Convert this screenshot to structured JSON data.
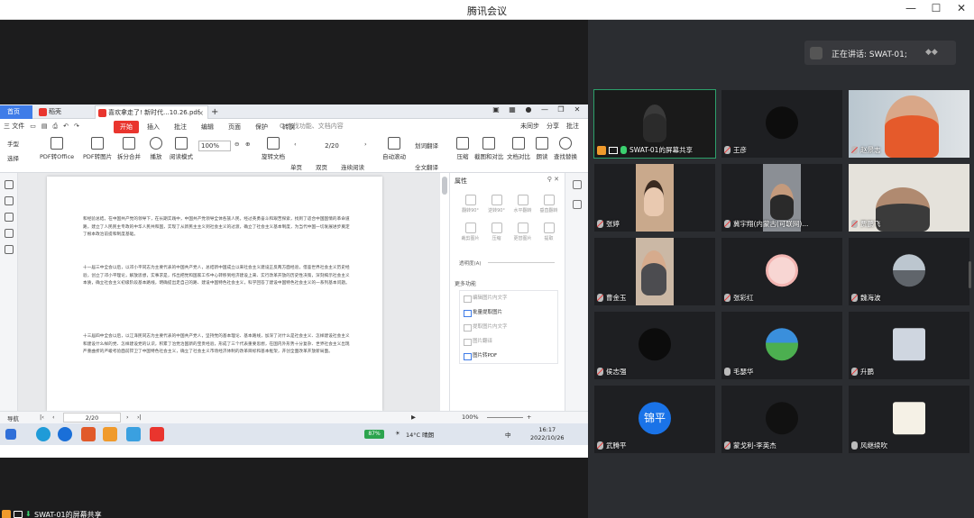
{
  "window": {
    "title": "腾讯会议"
  },
  "speaking": {
    "label": "正在讲话: SWAT-01;"
  },
  "sharer": {
    "label": "SWAT-01的屏幕共享"
  },
  "wps": {
    "tabs": {
      "home": "首页",
      "tab1": "稻壳",
      "tab2": "喜欢拿走了! 新时代...10.26.pdf"
    },
    "menu": {
      "file": "三 文件",
      "tabs": [
        "开始",
        "插入",
        "批注",
        "编辑",
        "页面",
        "保护",
        "转换"
      ],
      "active_tab": "开始",
      "search": "Q 查找功能、文档内容",
      "right": [
        "未同步",
        "分享",
        "批注"
      ]
    },
    "ribbon": {
      "hand": "手型",
      "select": "选择",
      "pdf_office": "PDF转Office",
      "pdf_img": "PDF转图片",
      "split": "拆分合并",
      "play": "播放",
      "read": "阅读模式",
      "zoom": "100%",
      "rotate": "旋转文档",
      "page": "2/20",
      "single": "单页",
      "double": "双页",
      "continuous": "连续阅读",
      "autoscroll": "自动滚动",
      "translate_region": "划词翻译",
      "translate_full": "全文翻译",
      "compress": "压缩",
      "screenshot": "截图和对比",
      "compare": "文档对比",
      "read_aloud": "朗读",
      "find_replace": "查找替换"
    },
    "properties": {
      "header": "属性",
      "tools": [
        "翻转90°",
        "逆转90°",
        "水平翻转",
        "垂直翻转",
        "裁剪图片",
        "压缩",
        "更替图片",
        "提取"
      ],
      "opacity": "透明度(A)",
      "section": "更多功能",
      "items": [
        "编辑图片内文字",
        "批量提取图片",
        "提取图片内文字",
        "图片翻译",
        "图片转PDF"
      ],
      "items_on": [
        false,
        true,
        false,
        false,
        true
      ]
    },
    "document": {
      "paragraphs": [
        "和经验总结。在中国共产党的领导下，在长期实践中，中国共产党领导全体各族人民，经过英勇奋斗和艰苦探索，找到了适合中国国情的革命道路，建立了人民民主专政的中华人民共和国，实现了从新民主主义到社会主义的过渡，确立了社会主义基本制度，为当代中国一切发展进步奠定了根本政治前提和制度基础。",
        "十一届三中全会以后，以邓小平同志为主要代表的中国共产党人，总结新中国成立以来社会主义建设正反两方面经验，借鉴世界社会主义历史经验，创立了邓小平理论，解放思想，实事求是，作出把党和国家工作中心转移到经济建设上来、实行改革开放的历史性决策，深刻揭示社会主义本质，确立社会主义初级阶段基本路线，明确提出走自己的路、建设中国特色社会主义，科学回答了建设中国特色社会主义的一系列基本问题。",
        "十三届四中全会以后，以江泽民同志为主要代表的中国共产党人，坚持党的基本理论、基本路线，加深了对什么是社会主义、怎样建设社会主义和建设什么样的党、怎样建设党的认识，积累了治党治国新的宝贵经验，形成了三个代表重要思想，在国内外形势十分复杂、世界社会主义出现严重曲折的严峻考验面前捍卫了中国特色社会主义，确立了社会主义市场经济体制的改革目标和基本框架，开创全面改革开放新局面。"
      ],
      "highlight": "中国共产党"
    },
    "status": {
      "nav": "导航",
      "page": "2/20",
      "zoom": "100%"
    }
  },
  "taskbar": {
    "battery": "87%",
    "weather": "14°C 晴朗",
    "ime": "中",
    "time": "16:17",
    "date": "2022/10/26"
  },
  "participants": [
    {
      "name": "SWAT-01的屏幕共享",
      "active": true,
      "muted": false,
      "sharing": true,
      "kind": "photo-dark"
    },
    {
      "name": "王彦",
      "muted": true,
      "kind": "circle-dark"
    },
    {
      "name": "赵景志",
      "muted": true,
      "kind": "photo-orange"
    },
    {
      "name": "张婷",
      "muted": true,
      "kind": "photo-girl"
    },
    {
      "name": "冀宇翔(内蒙古(可联网)...",
      "muted": true,
      "kind": "photo-man-room"
    },
    {
      "name": "贾鹏飞",
      "muted": true,
      "kind": "photo-glasses"
    },
    {
      "name": "曹金玉",
      "muted": true,
      "kind": "photo-selfie"
    },
    {
      "name": "张彩红",
      "muted": true,
      "kind": "circle-anime"
    },
    {
      "name": "魏海波",
      "muted": true,
      "kind": "circle-road"
    },
    {
      "name": "侯志强",
      "muted": true,
      "kind": "circle-man"
    },
    {
      "name": "毛瑟华",
      "muted": false,
      "kind": "circle-landscape"
    },
    {
      "name": "升鹏",
      "muted": true,
      "kind": "square-man"
    },
    {
      "name": "武腾平",
      "muted": true,
      "kind": "text-avatar",
      "avatar_text": "锦平"
    },
    {
      "name": "蒙戈利-李英杰",
      "muted": true,
      "kind": "circle-suit"
    },
    {
      "name": "风继续吹",
      "muted": false,
      "kind": "square-calligraphy"
    }
  ],
  "colors": {
    "accent": "#2ca06a",
    "wps_red": "#e9352e",
    "wps_blue": "#3f7ce8",
    "avatar_blue": "#1a73e8"
  }
}
